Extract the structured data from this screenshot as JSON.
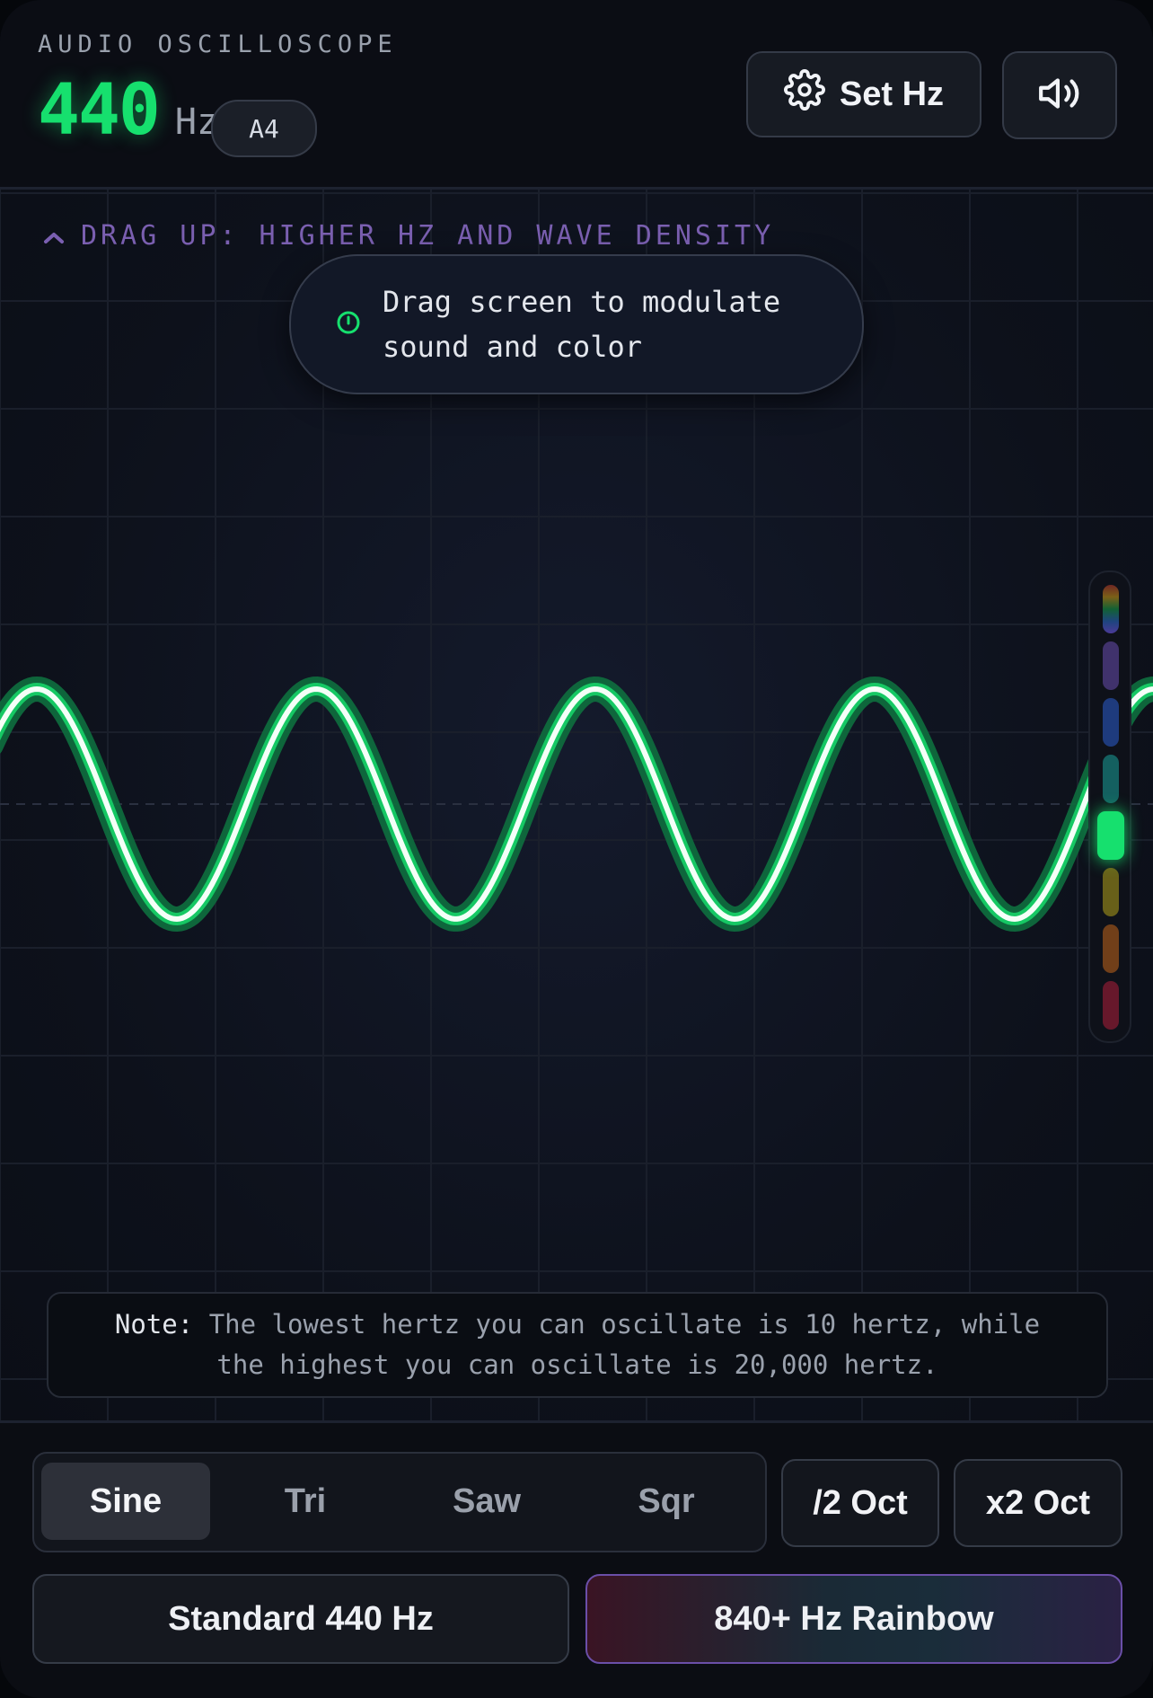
{
  "header": {
    "app_title": "AUDIO OSCILLOSCOPE",
    "frequency_value": "440",
    "frequency_unit": "Hz",
    "note_name": "A4",
    "set_hz_label": "Set Hz",
    "set_hz_icon": "gear-icon",
    "sound_icon": "speaker-volume-icon"
  },
  "scope": {
    "drag_hint": "DRAG UP: HIGHER HZ AND WAVE DENSITY",
    "drag_hint_icon": "chevron-up-icon",
    "tooltip_icon": "target-icon",
    "tooltip_text": "Drag screen to modulate sound and color",
    "waveform": "sine",
    "wave_color": "#16e06e",
    "spectrum_colors": [
      "#7c5cff",
      "#6a4fb0",
      "#2b5fd0",
      "#1aa39b",
      "#16e06e",
      "#b3a21a",
      "#c2661a",
      "#b01f3a"
    ],
    "spectrum_active_index": 4,
    "note_label": "Note:",
    "note_text": "The lowest hertz you can oscillate is 10 hertz, while the highest you can oscillate is 20,000 hertz."
  },
  "controls": {
    "wave_tabs": [
      "Sine",
      "Tri",
      "Saw",
      "Sqr"
    ],
    "active_tab": "Sine",
    "octave_down": "/2 Oct",
    "octave_up": "x2 Oct",
    "preset_standard": "Standard 440 Hz",
    "preset_rainbow": "840+ Hz Rainbow"
  },
  "colors": {
    "accent_green": "#16e06e",
    "hint_purple": "#7a5fb0",
    "background": "#0b0e15"
  }
}
